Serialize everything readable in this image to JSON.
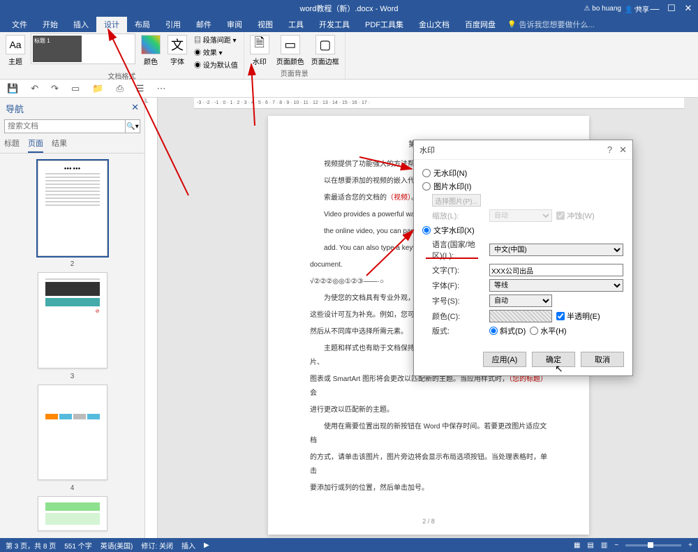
{
  "app": {
    "title": "word教程（新）.docx - Word",
    "user": "bo huang",
    "share": "共享"
  },
  "ribbon_tabs": {
    "items": [
      "文件",
      "开始",
      "插入",
      "设计",
      "布局",
      "引用",
      "邮件",
      "审阅",
      "视图",
      "工具",
      "开发工具",
      "PDF工具集",
      "金山文档",
      "百度网盘"
    ],
    "active": 3,
    "tell_me": "告诉我您想要做什么..."
  },
  "ribbon": {
    "theme": "主题",
    "theme_item": "标题 1",
    "colors": "颜色",
    "fonts": "字体",
    "paragraph_spacing": "段落间距",
    "effects": "效果",
    "set_default": "设为默认值",
    "watermark": "水印",
    "page_color": "页面颜色",
    "page_border": "页面边框",
    "group_format": "文档格式",
    "group_background": "页面背景"
  },
  "nav": {
    "title": "导航",
    "search_placeholder": "搜索文档",
    "tabs": [
      "标题",
      "页面",
      "结果"
    ],
    "active": 1,
    "thumb_nums": [
      "2",
      "3",
      "4"
    ]
  },
  "ruler": {
    "h": "-3 · -2 · -1 · 0 · 1 · 2 · 3 · 4 · 5 · 6 · 7 · 8 · 9 · 10 · 11 · 12 · 13 · 14 · 15 · 16 · 17 · "
  },
  "doc": {
    "sec_title": "第一节 XXX",
    "p1a": "视频提供了功能强大的方法帮...",
    "p1b": "以在想要添加的视频的嵌入代码中...",
    "p1c": "索最适合您的文档的",
    "p1c_red": "（视频）",
    "p1c_end": "。",
    "p2a": "Video provides a powerful way",
    "p2b": "the online video, you can paste in t",
    "p2c": "add. You can also type a keyword t",
    "p2d": "document.",
    "p3": "√②②②◎◎①②③——·○",
    "p4a": "为使您的文档具有专业外观，W",
    "p4b": "这些设计可互为补充。例如，您可以",
    "p4c": "然后从不同库中选择所需元素。",
    "p5a": "主题和样式也有助于文档保持协调。当您单击设计并选择新的主题时，图片、",
    "p5b_1": "图表或 SmartArt 图形将会更改以匹配新的主题。当应用样式时，",
    "p5b_red": "（您的标题）",
    "p5b_2": "会",
    "p5c": "进行更改以匹配新的主题。",
    "p6a": "使用在需要位置出现的新按钮在 Word 中保存时间。若要更改图片适应文档",
    "p6b": "的方式，请单击该图片，图片旁边将会显示布局选项按钮。当处理表格时，单击",
    "p6c": "要添加行或列的位置，然后单击加号。",
    "pg_num": "2 / 8"
  },
  "dialog": {
    "title": "水印",
    "no_wm": "无水印(N)",
    "pic_wm": "图片水印(I)",
    "select_pic": "选择图片(P)...",
    "scale": "缩放(L):",
    "auto": "自动",
    "washout": "冲蚀(W)",
    "text_wm": "文字水印(X)",
    "lang": "语言(国家/地区)(L):",
    "lang_val": "中文(中国)",
    "text": "文字(T):",
    "text_val": "XXX公司出品",
    "font": "字体(F):",
    "font_val": "等线",
    "size": "字号(S):",
    "size_val": "自动",
    "color": "颜色(C):",
    "semi": "半透明(E)",
    "layout": "版式:",
    "diag": "斜式(D)",
    "horiz": "水平(H)",
    "apply": "应用(A)",
    "ok": "确定",
    "cancel": "取消"
  },
  "status": {
    "page": "第 3 页，共 8 页",
    "words": "551 个字",
    "lang": "英语(美国)",
    "revise": "修订: 关闭",
    "insert": "插入"
  }
}
